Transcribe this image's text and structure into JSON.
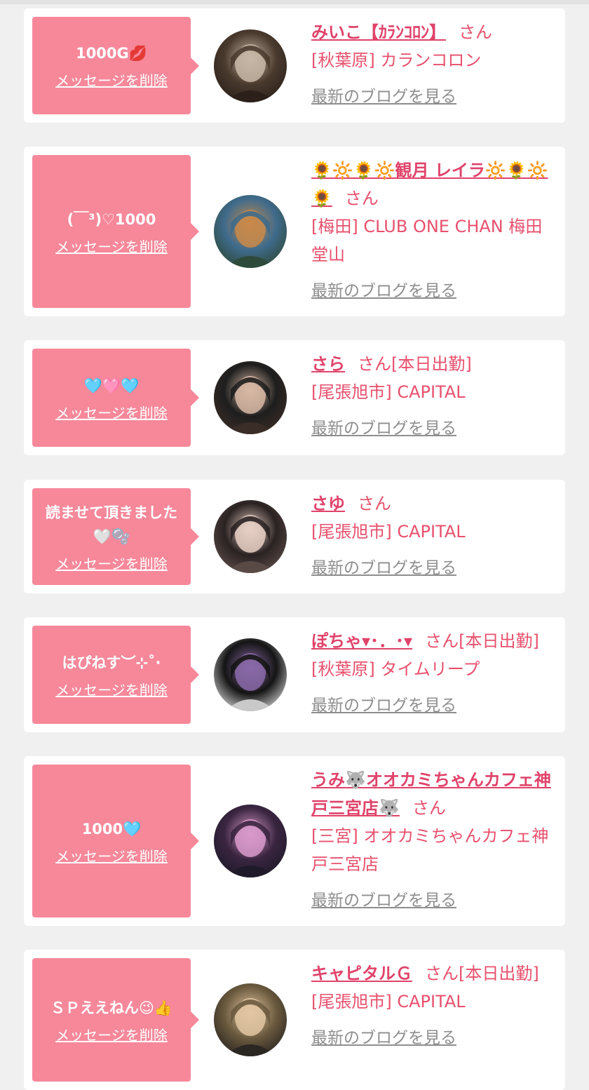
{
  "cards": [
    {
      "message": "1000G💋",
      "delete_label": "メッセージを削除",
      "name": "みいこ【ｶﾗﾝｺﾛﾝ】",
      "san": "さん",
      "status": "",
      "shop": "[秋葉原] カランコロン",
      "blog_link": "最新のブログを見る",
      "avatar_colors": [
        "#4a3a2e",
        "#c8b7a6",
        "#2b211a"
      ]
    },
    {
      "message": "(￣³)♡1000",
      "delete_label": "メッセージを削除",
      "name": "🌻🔆🌻🔆観月 レイラ🔆🌻🔆🌻",
      "san": "さん",
      "status": "",
      "shop": "[梅田] CLUB ONE CHAN 梅田堂山",
      "blog_link": "最新のブログを見る",
      "avatar_colors": [
        "#3f6b8c",
        "#c98a4a",
        "#2e4a3a"
      ]
    },
    {
      "message": "🩵🩷🩵",
      "delete_label": "メッセージを削除",
      "name": "さら",
      "san": "さん",
      "status": "[本日出勤]",
      "shop": "[尾張旭市] CAPITAL",
      "blog_link": "最新のブログを見る",
      "avatar_colors": [
        "#1e1e1e",
        "#d8b9a4",
        "#3a2c26"
      ]
    },
    {
      "message": "読ませて頂きました🤍🫧",
      "delete_label": "メッセージを削除",
      "name": "さゆ",
      "san": "さん",
      "status": "",
      "shop": "[尾張旭市] CAPITAL",
      "blog_link": "最新のブログを見る",
      "avatar_colors": [
        "#2a2222",
        "#e6cfc4",
        "#5a4a46"
      ]
    },
    {
      "message": "はぴねす︶⊹˚·",
      "delete_label": "メッセージを削除",
      "name": "ぽちゃ▾･．･▾",
      "san": "さん",
      "status": "[本日出勤]",
      "shop": "[秋葉原] タイムリープ",
      "blog_link": "最新のブログを見る",
      "avatar_colors": [
        "#141414",
        "#8a6aa8",
        "#c9c9c9"
      ]
    },
    {
      "message": "1000🩵",
      "delete_label": "メッセージを削除",
      "name": "うみ🐺オオカミちゃんカフェ神戸三宮店🐺",
      "san": "さん",
      "status": "",
      "shop": "[三宮] オオカミちゃんカフェ神戸三宮店",
      "blog_link": "最新のブログを見る",
      "avatar_colors": [
        "#3a2540",
        "#d99acb",
        "#1e1a2a"
      ]
    },
    {
      "message": "ＳＰええねん😉👍",
      "delete_label": "メッセージを削除",
      "name": "キャピタルＧ",
      "san": "さん",
      "status": "[本日出勤]",
      "shop": "[尾張旭市] CAPITAL",
      "blog_link": "最新のブログを見る",
      "avatar_colors": [
        "#6b5a3e",
        "#e3c7a3",
        "#2a2622"
      ]
    }
  ]
}
